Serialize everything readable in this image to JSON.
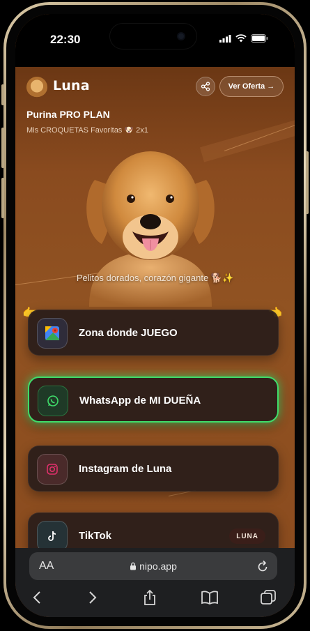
{
  "status": {
    "time": "22:30"
  },
  "profile": {
    "name": "Luna",
    "avatar_icon": "dog-avatar-icon",
    "share_icon": "share-icon",
    "offer_button": "Ver Oferta →"
  },
  "brand": {
    "title": "Purina PRO PLAN",
    "subtitle": "Mis CROQUETAS Favoritas 🐶 2x1"
  },
  "hero": {
    "image_icon": "golden-retriever-photo",
    "caption": "Pelitos dorados, corazón gigante 🐕✨"
  },
  "links": [
    {
      "label": "Zona donde JUEGO",
      "icon": "google-maps-icon",
      "left_pointer": "👉",
      "right_pointer": "👈"
    },
    {
      "label": "WhatsApp de MI DUEÑA",
      "icon": "whatsapp-icon",
      "highlight": "#3fdc6a"
    },
    {
      "label": "Instagram de Luna",
      "icon": "instagram-icon"
    },
    {
      "label": "TikTok",
      "icon": "tiktok-icon",
      "badge": "LUNA"
    }
  ],
  "browser": {
    "aa_label": "AA",
    "url": "nipo.app",
    "toolbar_icons": [
      "back-icon",
      "forward-icon",
      "share-icon",
      "bookmarks-icon",
      "tabs-icon"
    ]
  },
  "colors": {
    "background": "#8a4e22",
    "card": "#2a1c1a",
    "accent_green": "#3fdc6a"
  }
}
